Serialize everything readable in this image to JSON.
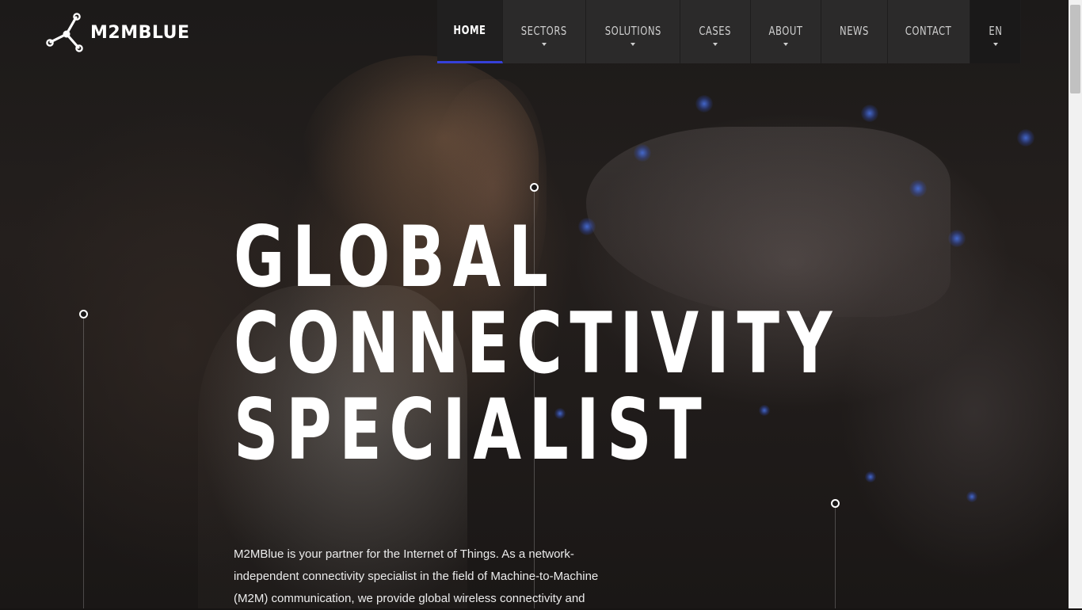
{
  "brand": {
    "name": "M2MBLUE"
  },
  "nav": {
    "items": [
      {
        "label": "HOME",
        "active": true,
        "dropdown": false
      },
      {
        "label": "SECTORS",
        "active": false,
        "dropdown": true
      },
      {
        "label": "SOLUTIONS",
        "active": false,
        "dropdown": true
      },
      {
        "label": "CASES",
        "active": false,
        "dropdown": true
      },
      {
        "label": "ABOUT",
        "active": false,
        "dropdown": true
      },
      {
        "label": "NEWS",
        "active": false,
        "dropdown": false
      },
      {
        "label": "CONTACT",
        "active": false,
        "dropdown": false
      }
    ],
    "language": "EN"
  },
  "hero": {
    "lines": [
      "GLOBAL",
      "CONNECTIVITY",
      "SPECIALIST"
    ],
    "intro": "M2MBlue is your partner for the Internet of Things. As a network-independent connectivity specialist in the field of Machine-to-Machine (M2M) communication, we provide global wireless connectivity and"
  },
  "colors": {
    "accent": "#3640d8",
    "nav_bg": "#2b2a2a",
    "page_bg": "#1c1a19"
  }
}
